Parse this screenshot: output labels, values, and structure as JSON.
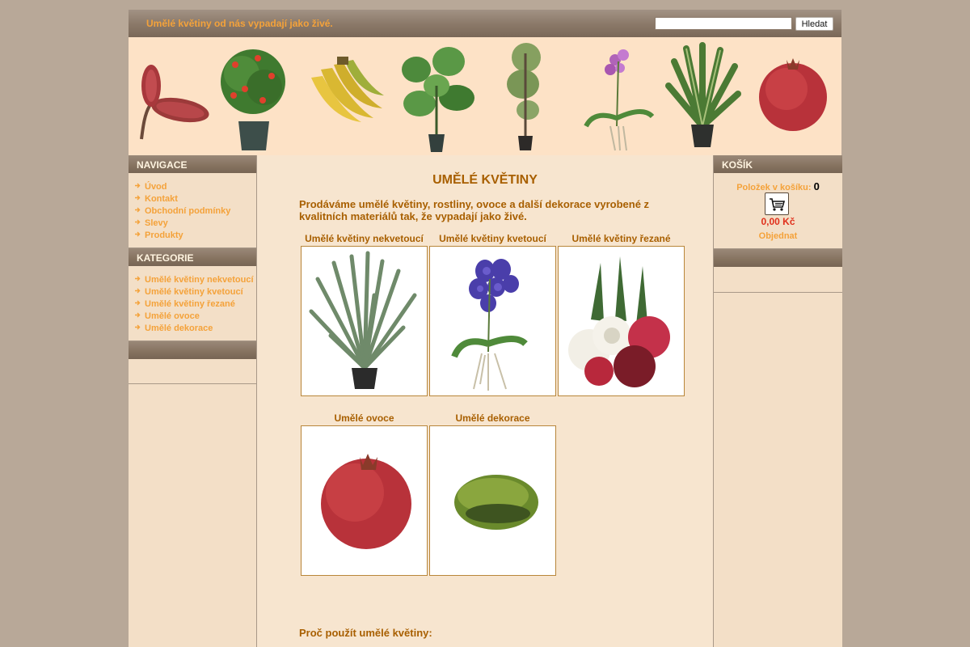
{
  "header": {
    "tagline": "Umělé květiny od nás vypadají jako živé.",
    "search": {
      "value": "",
      "placeholder": "",
      "button_label": "Hledat"
    }
  },
  "navigation": {
    "title": "NAVIGACE",
    "items": [
      {
        "label": "Úvod"
      },
      {
        "label": "Kontakt"
      },
      {
        "label": "Obchodní podmínky"
      },
      {
        "label": "Slevy"
      },
      {
        "label": "Produkty"
      }
    ]
  },
  "categories_menu": {
    "title": "KATEGORIE",
    "items": [
      {
        "label": "Umělé květiny nekvetoucí"
      },
      {
        "label": "Umělé květiny kvetoucí"
      },
      {
        "label": "Umělé květiny řezané"
      },
      {
        "label": "Umělé ovoce"
      },
      {
        "label": "Umělé dekorace"
      }
    ]
  },
  "cart": {
    "title": "KOŠÍK",
    "items_label": "Položek v košíku:",
    "items_count": "0",
    "total": "0,00 Kč",
    "order_label": "Objednat",
    "icon": "shopping-cart-icon"
  },
  "main": {
    "title": "UMĚLÉ KVĚTINY",
    "intro": "Prodáváme umělé květiny, rostliny, ovoce a další dekorace vyrobené z kvalitních materiálů tak, že vypadají jako živé.",
    "categories": [
      {
        "label": "Umělé květiny nekvetoucí",
        "image": "agave-plant"
      },
      {
        "label": "Umělé květiny kvetoucí",
        "image": "blue-orchid"
      },
      {
        "label": "Umělé květiny řezané",
        "image": "tulip-bouquet"
      },
      {
        "label": "Umělé ovoce",
        "image": "pomegranate"
      },
      {
        "label": "Umělé dekorace",
        "image": "moss-ball"
      }
    ],
    "why_heading": "Proč použít umělé květiny:"
  },
  "banner": {
    "images": [
      "banksia-flower",
      "rose-tree-pot",
      "banana-bunch",
      "pothos-plant-pot",
      "olive-tree-pot",
      "purple-orchid",
      "dracaena-pot",
      "pomegranate"
    ]
  },
  "colors": {
    "accent_orange": "#f4a23a",
    "title_brown": "#a85f00",
    "price_red": "#e0301c",
    "page_bg": "#f7e5cf",
    "outer_bg": "#b8a898",
    "header_bar": "#8a7868"
  }
}
